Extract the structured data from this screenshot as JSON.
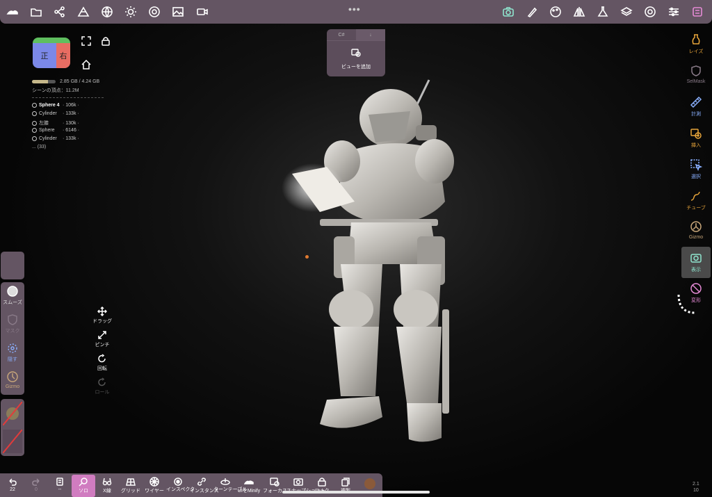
{
  "top_toolbar": {
    "left_icons": [
      "logo-icon",
      "folder-icon",
      "scene-graph-icon",
      "pyramid-icon",
      "globe-icon",
      "sun-icon",
      "material-icon",
      "image-icon",
      "video-icon"
    ],
    "right_icons": [
      "camera-icon",
      "brush-icon",
      "palette-icon",
      "symmetry-icon",
      "flask-icon",
      "layers-icon",
      "settings-icon",
      "sliders-icon",
      "menu-icon"
    ],
    "dots": "•••",
    "active_color": "#8fe6cf"
  },
  "view_popup": {
    "tabs": [
      "C#",
      "↓"
    ],
    "add_label": "ビューを追加"
  },
  "cube": {
    "front": "正",
    "side": "右"
  },
  "memory": {
    "text": "2.85 GB / 4.24 GB",
    "fraction": 0.67
  },
  "scene": {
    "vertices": "シーンの頂点：11.2M",
    "objects": [
      {
        "name": "Sphere 4",
        "count": "· 106k ·"
      },
      {
        "name": "Cylinder",
        "count": "· 133k ·"
      },
      {
        "name": "左膝",
        "count": "· 130k ·"
      },
      {
        "name": "Sphere",
        "count": "· 6146 ·"
      },
      {
        "name": "Cylinder",
        "count": "· 133k ·"
      }
    ],
    "more": "... (33)"
  },
  "left_tools": {
    "smooth": "スムーズ",
    "mask": "マスク",
    "hide": "隠す",
    "gizmo": "Gizmo"
  },
  "gestures": {
    "drag": "ドラッグ",
    "pinch": "ピンチ",
    "rotate": "回転",
    "roll": "ロール"
  },
  "right_tools": [
    {
      "label": "レイズ",
      "color": "#e8a53a"
    },
    {
      "label": "SelMask",
      "color": "#8a7b89"
    },
    {
      "label": "計測",
      "color": "#8ab0ff"
    },
    {
      "label": "挿入",
      "color": "#e8a53a"
    },
    {
      "label": "選択",
      "color": "#8ab0ff"
    },
    {
      "label": "チューブ",
      "color": "#e8a53a"
    },
    {
      "label": "Gizmo",
      "color": "#c9a77a"
    },
    {
      "label": "表示",
      "color": "#8fe6cf"
    },
    {
      "label": "変形",
      "color": "#e58ad5"
    }
  ],
  "bottom_bar": {
    "undo_count": "22",
    "redo_count": "0",
    "item3": "--",
    "solo": "ソロ",
    "xray": "X線",
    "grid": "グリッド",
    "wire": "ワイヤー",
    "inspector": "インスペクタ",
    "instance": "インスタンス",
    "turntable": "ターンテーブル",
    "minify": "UIをMinify",
    "b12": "フォーカス",
    "b13": "スナップショット",
    "b14": "ロック",
    "b15": "複製"
  },
  "version": [
    "2.1",
    "10"
  ]
}
